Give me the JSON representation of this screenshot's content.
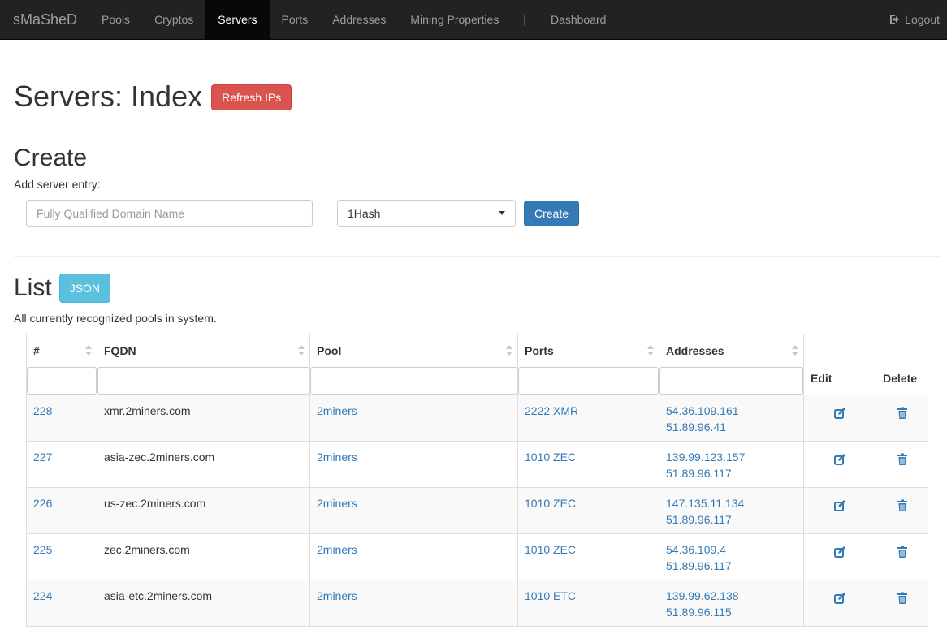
{
  "nav": {
    "brand": "sMaSheD",
    "items": [
      "Pools",
      "Cryptos",
      "Servers",
      "Ports",
      "Addresses",
      "Mining Properties"
    ],
    "separator": "|",
    "dashboard": "Dashboard",
    "logout": "Logout"
  },
  "page": {
    "title": "Servers: Index",
    "refresh_label": "Refresh IPs"
  },
  "create": {
    "title": "Create",
    "subtitle": "Add server entry:",
    "fqdn_placeholder": "Fully Qualified Domain Name",
    "pool_selected": "1Hash",
    "create_label": "Create"
  },
  "list": {
    "title": "List",
    "json_label": "JSON",
    "subtitle": "All currently recognized pools in system.",
    "columns": {
      "id": "#",
      "fqdn": "FQDN",
      "pool": "Pool",
      "ports": "Ports",
      "addresses": "Addresses",
      "edit": "Edit",
      "delete": "Delete"
    },
    "rows": [
      {
        "id": "228",
        "fqdn": "xmr.2miners.com",
        "pool": "2miners",
        "ports": "2222 XMR",
        "addr1": "54.36.109.161",
        "addr2": "51.89.96.41"
      },
      {
        "id": "227",
        "fqdn": "asia-zec.2miners.com",
        "pool": "2miners",
        "ports": "1010 ZEC",
        "addr1": "139.99.123.157",
        "addr2": "51.89.96.117"
      },
      {
        "id": "226",
        "fqdn": "us-zec.2miners.com",
        "pool": "2miners",
        "ports": "1010 ZEC",
        "addr1": "147.135.11.134",
        "addr2": "51.89.96.117"
      },
      {
        "id": "225",
        "fqdn": "zec.2miners.com",
        "pool": "2miners",
        "ports": "1010 ZEC",
        "addr1": "54.36.109.4",
        "addr2": "51.89.96.117"
      },
      {
        "id": "224",
        "fqdn": "asia-etc.2miners.com",
        "pool": "2miners",
        "ports": "1010 ETC",
        "addr1": "139.99.62.138",
        "addr2": "51.89.96.115"
      }
    ]
  },
  "colors": {
    "navbar": "#222222",
    "danger": "#d9534f",
    "primary": "#337ab7",
    "info": "#5bc0de",
    "link": "#337ab7"
  },
  "icons": {
    "edit": "edit-icon",
    "delete": "trash-icon",
    "logout": "logout-icon"
  }
}
